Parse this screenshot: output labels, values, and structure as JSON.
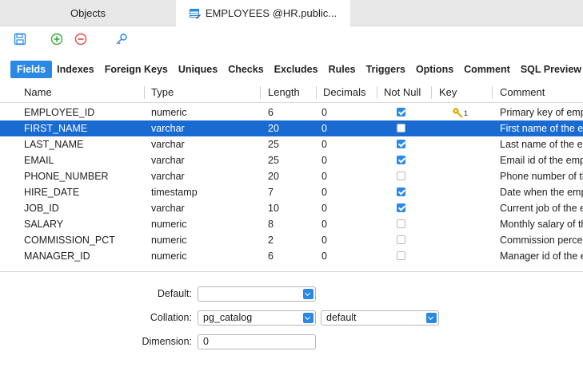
{
  "doc_tabs": [
    {
      "label": "Objects"
    },
    {
      "label": "EMPLOYEES @HR.public..."
    }
  ],
  "subtabs": [
    "Fields",
    "Indexes",
    "Foreign Keys",
    "Uniques",
    "Checks",
    "Excludes",
    "Rules",
    "Triggers",
    "Options",
    "Comment",
    "SQL Preview"
  ],
  "columns": {
    "name": "Name",
    "type": "Type",
    "length": "Length",
    "decimals": "Decimals",
    "not_null": "Not Null",
    "key": "Key",
    "comment": "Comment"
  },
  "rows": [
    {
      "name": "EMPLOYEE_ID",
      "type": "numeric",
      "length": "6",
      "decimals": "0",
      "not_null": true,
      "key": "1",
      "comment": "Primary key of employees"
    },
    {
      "name": "FIRST_NAME",
      "type": "varchar",
      "length": "20",
      "decimals": "0",
      "not_null": false,
      "key": "",
      "comment": "First name of the employee"
    },
    {
      "name": "LAST_NAME",
      "type": "varchar",
      "length": "25",
      "decimals": "0",
      "not_null": true,
      "key": "",
      "comment": "Last name of the employee"
    },
    {
      "name": "EMAIL",
      "type": "varchar",
      "length": "25",
      "decimals": "0",
      "not_null": true,
      "key": "",
      "comment": "Email id of the employee"
    },
    {
      "name": "PHONE_NUMBER",
      "type": "varchar",
      "length": "20",
      "decimals": "0",
      "not_null": false,
      "key": "",
      "comment": "Phone number of the employee"
    },
    {
      "name": "HIRE_DATE",
      "type": "timestamp",
      "length": "7",
      "decimals": "0",
      "not_null": true,
      "key": "",
      "comment": "Date when the employee started"
    },
    {
      "name": "JOB_ID",
      "type": "varchar",
      "length": "10",
      "decimals": "0",
      "not_null": true,
      "key": "",
      "comment": "Current job of the employee"
    },
    {
      "name": "SALARY",
      "type": "numeric",
      "length": "8",
      "decimals": "0",
      "not_null": false,
      "key": "",
      "comment": "Monthly salary of the employee"
    },
    {
      "name": "COMMISSION_PCT",
      "type": "numeric",
      "length": "2",
      "decimals": "0",
      "not_null": false,
      "key": "",
      "comment": "Commission percentage"
    },
    {
      "name": "MANAGER_ID",
      "type": "numeric",
      "length": "6",
      "decimals": "0",
      "not_null": false,
      "key": "",
      "comment": "Manager id of the employee"
    }
  ],
  "selected_row": 1,
  "properties": {
    "default_label": "Default:",
    "default_value": "",
    "collation_label": "Collation:",
    "collation_value": "pg_catalog",
    "collation_value2": "default",
    "dimension_label": "Dimension:",
    "dimension_value": "0"
  },
  "colors": {
    "accent": "#2a8ae3",
    "selection": "#1a6bd1",
    "key_icon": "#e0a800"
  }
}
